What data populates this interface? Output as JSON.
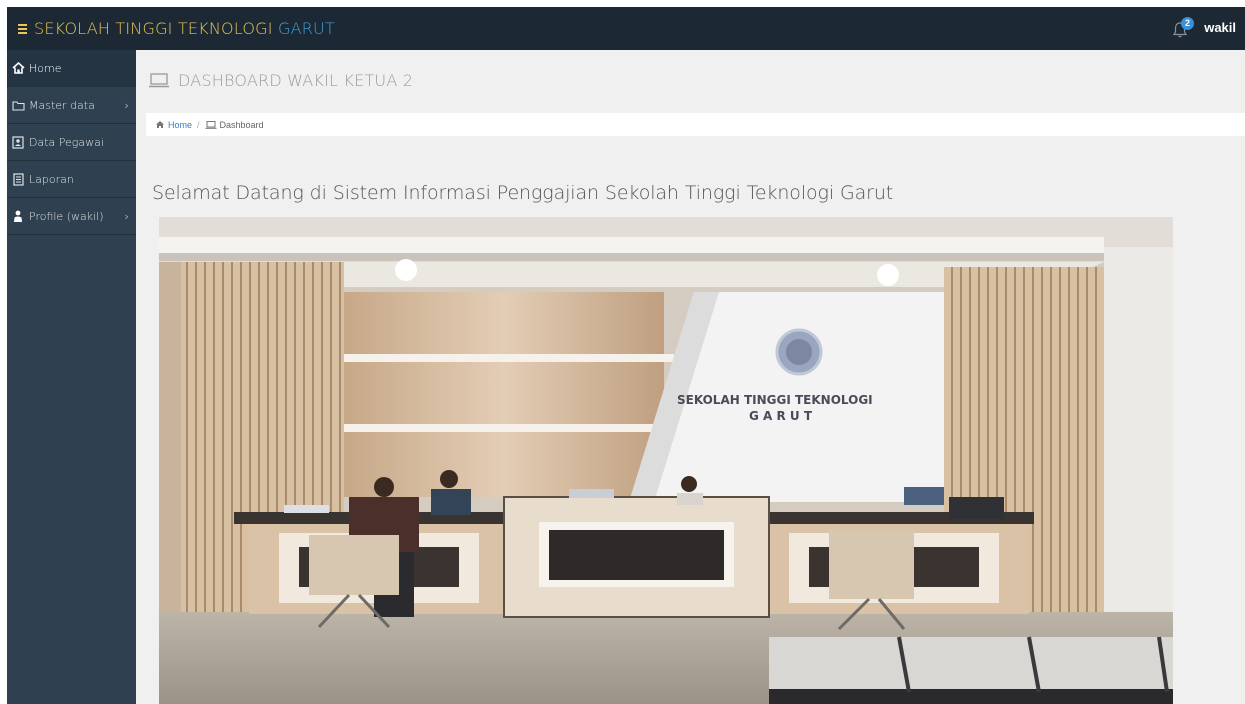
{
  "header": {
    "brand_part1": "SEKOLAH TINGGI TEKNOLOGI",
    "brand_part2": "GARUT",
    "notification_count": "2",
    "user": "wakil"
  },
  "sidebar": {
    "items": [
      {
        "label": "Home",
        "icon": "home-icon",
        "has_submenu": false
      },
      {
        "label": "Master data",
        "icon": "folder-icon",
        "has_submenu": true
      },
      {
        "label": "Data Pegawai",
        "icon": "address-book-icon",
        "has_submenu": false
      },
      {
        "label": "Laporan",
        "icon": "report-icon",
        "has_submenu": false
      },
      {
        "label": "Profile (wakil)",
        "icon": "user-icon",
        "has_submenu": true
      }
    ]
  },
  "page": {
    "title": "DASHBOARD WAKIL KETUA 2",
    "breadcrumb_home": "Home",
    "breadcrumb_current": "Dashboard",
    "welcome": "Selamat Datang di Sistem Informasi Penggajian Sekolah Tinggi Teknologi Garut"
  },
  "photo": {
    "sign_line1": "SEKOLAH TINGGI TEKNOLOGI",
    "sign_line2": "G A R U T"
  },
  "colors": {
    "topbar": "#1c2833",
    "sidebar": "#2f4050",
    "brand_yellow": "#e8c65a",
    "brand_blue": "#3fa3e0"
  }
}
